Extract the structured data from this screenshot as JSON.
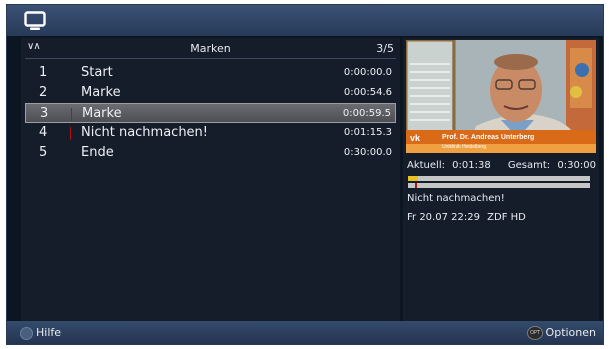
{
  "header": {
    "icon": "tv-icon"
  },
  "list": {
    "title": "Marken",
    "position": "3/5",
    "sort_icon": "sort-arrows-icon",
    "items": [
      {
        "num": "1",
        "name": "Start",
        "time": "0:00:00.0",
        "selected": false,
        "marker": false
      },
      {
        "num": "2",
        "name": "Marke",
        "time": "0:00:54.6",
        "selected": false,
        "marker": false
      },
      {
        "num": "3",
        "name": "Marke",
        "time": "0:00:59.5",
        "selected": true,
        "marker": true
      },
      {
        "num": "4",
        "name": "Nicht nachmachen!",
        "time": "0:01:15.3",
        "selected": false,
        "marker": true
      },
      {
        "num": "5",
        "name": "Ende",
        "time": "0:30:00.0",
        "selected": false,
        "marker": false
      }
    ]
  },
  "preview": {
    "caption_name": "Prof. Dr. Andreas Unterberg",
    "caption_sub": "Uniklinik Heidelberg",
    "logo": "vk",
    "aktuell_label": "Aktuell:",
    "aktuell_value": "0:01:38",
    "gesamt_label": "Gesamt:",
    "gesamt_value": "0:30:00",
    "progress": 0.054,
    "title": "Nicht nachmachen!",
    "date": "Fr 20.07 22:29",
    "channel": "ZDF HD",
    "colors": {
      "progress": "#e8c020",
      "marker": "#b31212",
      "bar": "#c6c6c6"
    }
  },
  "footer": {
    "help_label": "Hilfe",
    "options_label": "Optionen",
    "options_button_text": "OPT"
  }
}
